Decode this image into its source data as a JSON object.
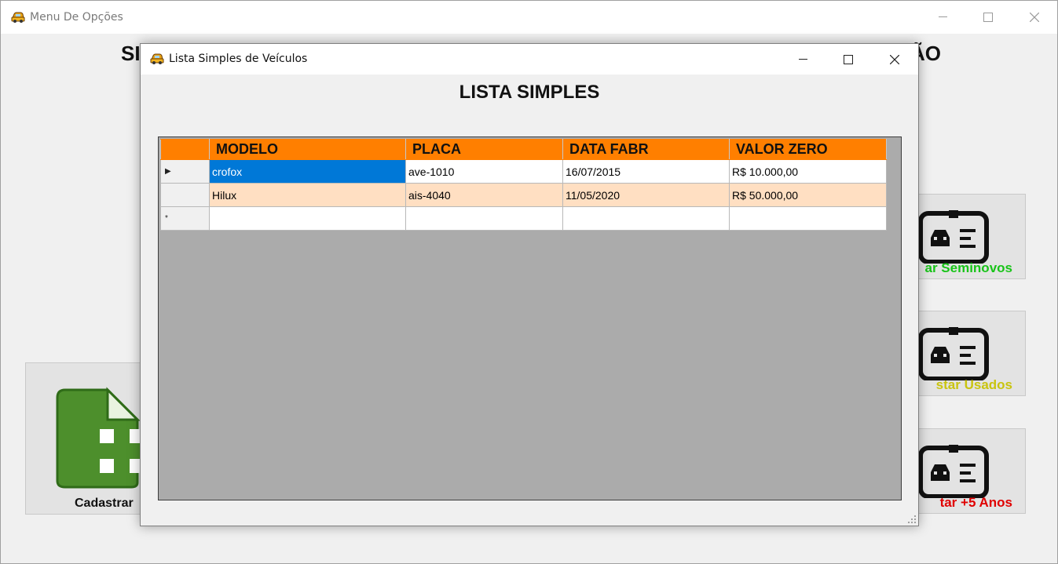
{
  "main_window": {
    "title": "Menu De Opções",
    "heading_left": "SI",
    "heading_right": "ÃO",
    "cards": {
      "cadastrar_label": "Cadastrar",
      "seminovos_label": "ar Seminovos",
      "usados_label": "star Usados",
      "mais5_label": "tar +5 Anos"
    }
  },
  "dialog": {
    "title": "Lista Simples de Veículos",
    "heading": "LISTA SIMPLES",
    "grid": {
      "columns": [
        "MODELO",
        "PLACA",
        "DATA FABR",
        "VALOR ZERO"
      ],
      "rows": [
        {
          "marker": "▶",
          "modelo": "crofox",
          "placa": "ave-1010",
          "data_fabr": "16/07/2015",
          "valor_zero": "R$ 10.000,00"
        },
        {
          "marker": "",
          "modelo": "Hilux",
          "placa": "ais-4040",
          "data_fabr": "11/05/2020",
          "valor_zero": "R$ 50.000,00"
        }
      ],
      "new_row_marker": "*"
    }
  },
  "colors": {
    "header_orange": "#ff7f00",
    "alt_row": "#ffdfc2",
    "selection": "#0078d7",
    "seminovos_green": "#19c419",
    "usados_yellow": "#c9c40f",
    "mais5_red": "#e00000"
  }
}
